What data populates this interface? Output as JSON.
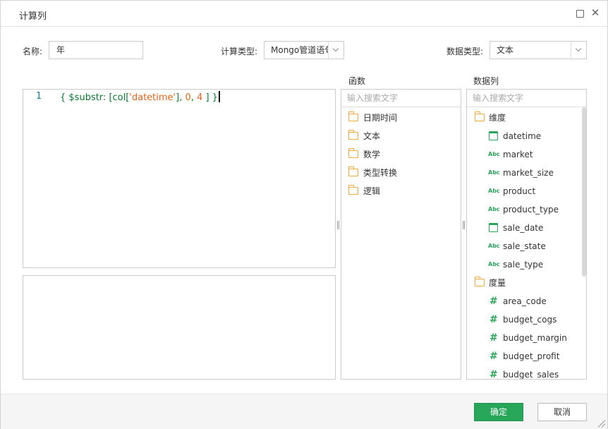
{
  "dialog": {
    "title": "计算列"
  },
  "form": {
    "name_label": "名称:",
    "name_value": "年",
    "calc_type_label": "计算类型:",
    "calc_type_value": "Mongo管道语句",
    "data_type_label": "数据类型:",
    "data_type_value": "文本"
  },
  "editor": {
    "line_number": "1",
    "tokens": {
      "open": "{ ",
      "fn": "$substr: [col[",
      "str": "'datetime'",
      "mid": "], ",
      "n1": "0",
      "comma": ", ",
      "n2": "4",
      "close": " ] }"
    }
  },
  "functions": {
    "title": "函数",
    "search_placeholder": "输入搜索文字",
    "items": [
      "日期时间",
      "文本",
      "数学",
      "类型转换",
      "逻辑"
    ]
  },
  "columns": {
    "title": "数据列",
    "search_placeholder": "输入搜索文字",
    "groups": [
      {
        "label": "维度",
        "icon": "folder-icon"
      },
      {
        "label": "度量",
        "icon": "folder-icon"
      }
    ],
    "dimensions": [
      {
        "name": "datetime",
        "icon": "calendar-icon"
      },
      {
        "name": "market",
        "icon": "abc-icon",
        "glyph": "Abc"
      },
      {
        "name": "market_size",
        "icon": "abc-icon",
        "glyph": "Abc"
      },
      {
        "name": "product",
        "icon": "abc-icon",
        "glyph": "Abc"
      },
      {
        "name": "product_type",
        "icon": "abc-icon",
        "glyph": "Abc"
      },
      {
        "name": "sale_date",
        "icon": "calendar-icon"
      },
      {
        "name": "sale_state",
        "icon": "abc-icon",
        "glyph": "Abc"
      },
      {
        "name": "sale_type",
        "icon": "abc-icon",
        "glyph": "Abc"
      }
    ],
    "measures": [
      {
        "name": "area_code",
        "icon": "hash-icon",
        "glyph": "#"
      },
      {
        "name": "budget_cogs",
        "icon": "hash-icon",
        "glyph": "#"
      },
      {
        "name": "budget_margin",
        "icon": "hash-icon",
        "glyph": "#"
      },
      {
        "name": "budget_profit",
        "icon": "hash-icon",
        "glyph": "#"
      },
      {
        "name": "budget_sales",
        "icon": "hash-icon",
        "glyph": "#"
      }
    ]
  },
  "footer": {
    "ok_label": "确定",
    "cancel_label": "取消"
  },
  "colors": {
    "accent": "#28a75a",
    "folder": "#f0a73c",
    "string_token": "#e0651a"
  }
}
